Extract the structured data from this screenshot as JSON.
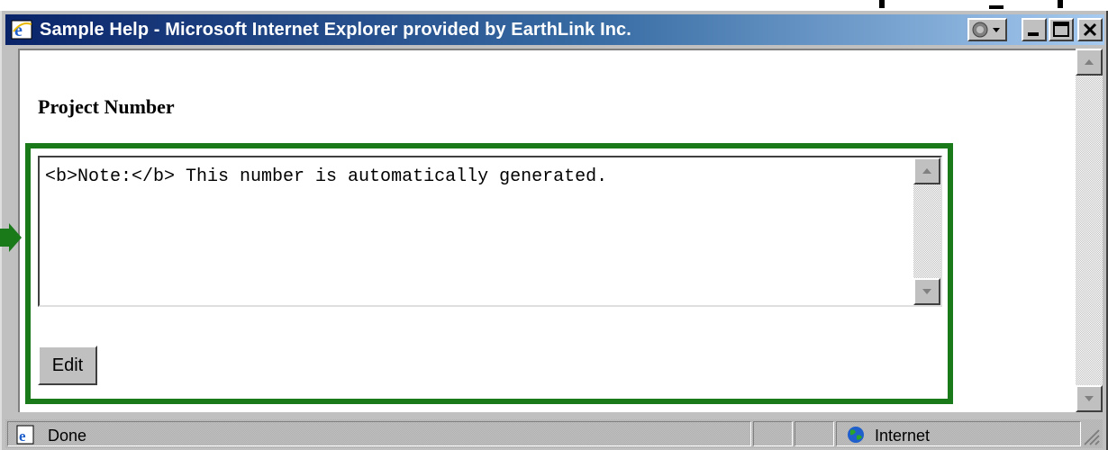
{
  "window": {
    "title": "Sample Help - Microsoft Internet Explorer provided by EarthLink Inc."
  },
  "page": {
    "heading": "Project Number",
    "textarea_value": "<b>Note:</b> This number is automatically generated.",
    "edit_button_label": "Edit"
  },
  "statusbar": {
    "status": "Done",
    "zone": "Internet"
  },
  "colors": {
    "highlight": "#1a7a1a",
    "titlebar_start": "#0a246a",
    "titlebar_end": "#a6caf0"
  },
  "icons": [
    "ie-icon",
    "nav-globe-icon",
    "minimize-icon",
    "maximize-icon",
    "close-icon",
    "scroll-up-icon",
    "scroll-down-icon",
    "pointer-arrow-icon",
    "ie-page-icon",
    "globe-icon"
  ]
}
